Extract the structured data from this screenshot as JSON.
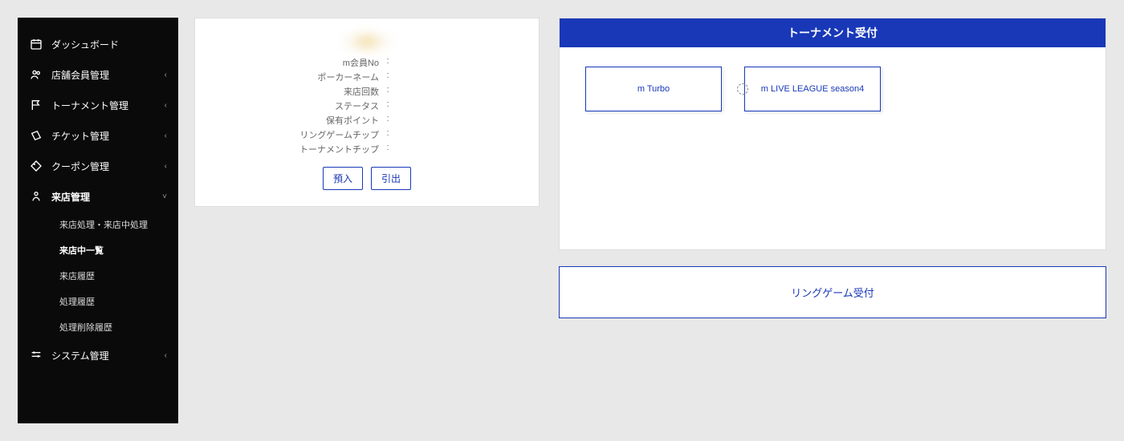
{
  "sidebar": {
    "dashboard": "ダッシュボード",
    "store_member": "店舗会員管理",
    "tournament": "トーナメント管理",
    "ticket": "チケット管理",
    "coupon": "クーポン管理",
    "visit": "来店管理",
    "visit_sub": {
      "process": "来店処理・来店中処理",
      "in_list": "来店中一覧",
      "history": "来店履歴",
      "proc_history": "処理履歴",
      "del_history": "処理削除履歴"
    },
    "system": "システム管理"
  },
  "profile": {
    "fields": {
      "member_no": "m会員No",
      "poker_name": "ポーカーネーム",
      "visits": "来店回数",
      "status": "ステータス",
      "points": "保有ポイント",
      "ring_chip": "リングゲームチップ",
      "tournament_chip": "トーナメントチップ"
    },
    "deposit_btn": "預入",
    "withdraw_btn": "引出"
  },
  "tournament": {
    "header": "トーナメント受付",
    "options": {
      "turbo": "m Turbo",
      "live_league": "m LIVE LEAGUE season4"
    }
  },
  "ring_game": {
    "label": "リングゲーム受付"
  }
}
